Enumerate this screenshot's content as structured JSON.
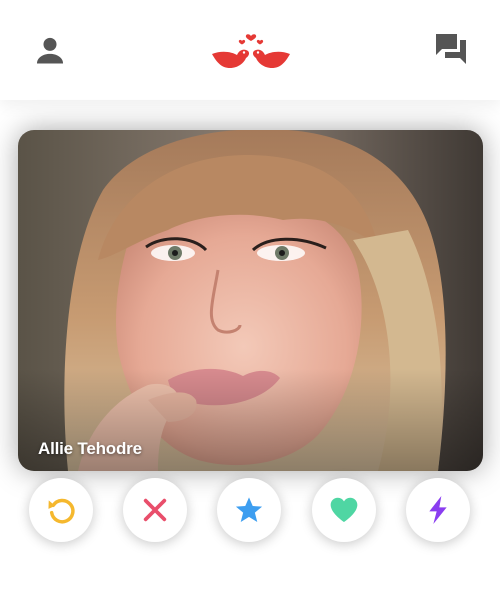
{
  "profile": {
    "name": "Allie Tehodre"
  },
  "icons": {
    "header_left": "person-icon",
    "logo": "love-birds-logo",
    "header_right": "chat-bubbles-icon",
    "rewind": "rewind-icon",
    "nope": "x-icon",
    "superlike": "star-icon",
    "like": "heart-icon",
    "boost": "lightning-icon"
  },
  "colors": {
    "header_icon": "#555555",
    "logo": "#e53935",
    "rewind": "#f5b82e",
    "nope": "#e94e6b",
    "superlike": "#3d9ef0",
    "like": "#4fd6a3",
    "boost": "#8a3df0"
  }
}
